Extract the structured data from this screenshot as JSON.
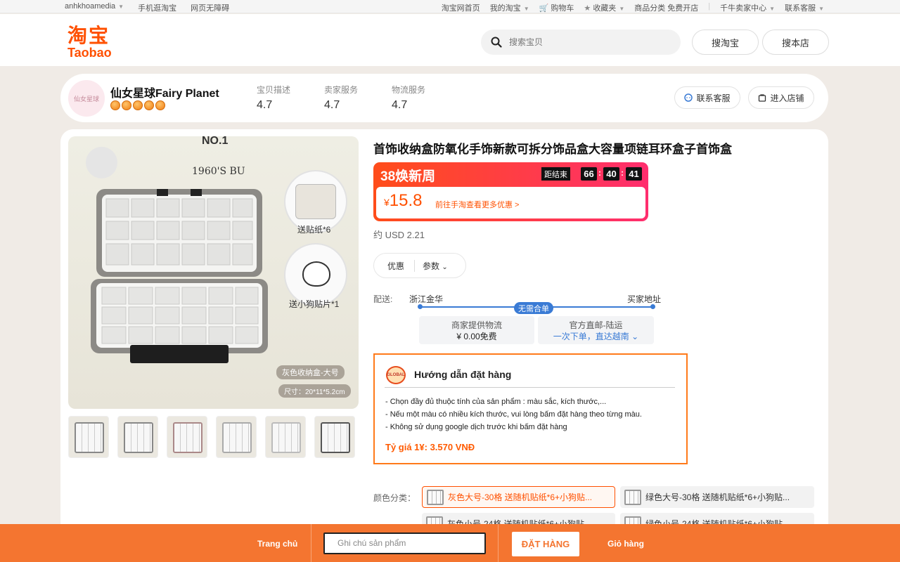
{
  "topbar": {
    "user": "anhkhoamedia",
    "links_left": [
      "手机逛淘宝",
      "网页无障碍"
    ],
    "links_right": [
      "淘宝网首页",
      "我的淘宝",
      "购物车",
      "收藏夹",
      "商品分类 免费开店",
      "千牛卖家中心",
      "联系客服"
    ]
  },
  "header": {
    "logo_cn": "淘宝",
    "logo_en": "Taobao",
    "search_placeholder": "搜索宝贝",
    "search_taobao": "搜淘宝",
    "search_shop": "搜本店"
  },
  "shop": {
    "avatar_text": "仙女星球",
    "name": "仙女星球Fairy Planet",
    "medal_count": 5,
    "scores": [
      {
        "label": "宝贝描述",
        "value": "4.7"
      },
      {
        "label": "卖家服务",
        "value": "4.7"
      },
      {
        "label": "物流服务",
        "value": "4.7"
      }
    ],
    "contact": "联系客服",
    "enter": "进入店铺"
  },
  "product": {
    "title": "首饰收纳盒防氧化手饰新款可拆分饰品盒大容量项链耳环盒子首饰盒",
    "image": {
      "top_text": "NO.1",
      "brand_text": "1960'S BU",
      "sticker_tag": "送贴纸*6",
      "dog_tag": "送小狗贴片*1",
      "variant_tag": "灰色收纳盒-大号",
      "size_tag": "尺寸：20*11*5.2cm"
    },
    "thumbnail_count": 6,
    "promo": {
      "event": "38焕新周",
      "end_label": "距结束",
      "timer": [
        "66",
        "40",
        "41"
      ],
      "currency": "¥",
      "price": "15.8",
      "note": "前往手淘查看更多优惠 >"
    },
    "usd": "约 USD 2.21",
    "chips": {
      "discount": "优惠",
      "params": "参数"
    },
    "shipping": {
      "label": "配送:",
      "from": "浙江金华",
      "to": "买家地址",
      "badge": "无需合单",
      "box1_line1": "商家提供物流",
      "box1_line2": "¥ 0.00免费",
      "box2_line1": "官方直邮-陆运",
      "box2_line2": "一次下单，直达越南"
    },
    "guide": {
      "logo_text": "GLOBAL",
      "title": "Hướng dẫn đặt hàng",
      "lines": [
        "- Chọn đầy đủ thuộc tính của sản phẩm : màu sắc, kích thước,...",
        "- Nếu một màu có nhiều kích thước, vui lòng bấm đặt hàng theo từng màu.",
        "- Không sử dụng google dịch trước khi bấm đặt hàng"
      ],
      "rate": "Tỷ giá 1¥: 3.570 VNĐ"
    },
    "color_label": "颜色分类：",
    "options": [
      "灰色大号-30格 送随机贴纸*6+小狗贴...",
      "绿色大号-30格 送随机贴纸*6+小狗贴...",
      "灰色小号-24格 送随机贴纸*6+小狗贴...",
      "绿色小号-24格 送随机贴纸*6+小狗贴..."
    ]
  },
  "bottombar": {
    "home": "Trang chủ",
    "note_placeholder": "Ghi chú sản phẩm",
    "order": "ĐẶT HÀNG",
    "cart": "Giỏ hàng"
  },
  "colors": {
    "brand": "#ff5000",
    "bottombar": "#f47530",
    "link_blue": "#3a7bd5"
  }
}
